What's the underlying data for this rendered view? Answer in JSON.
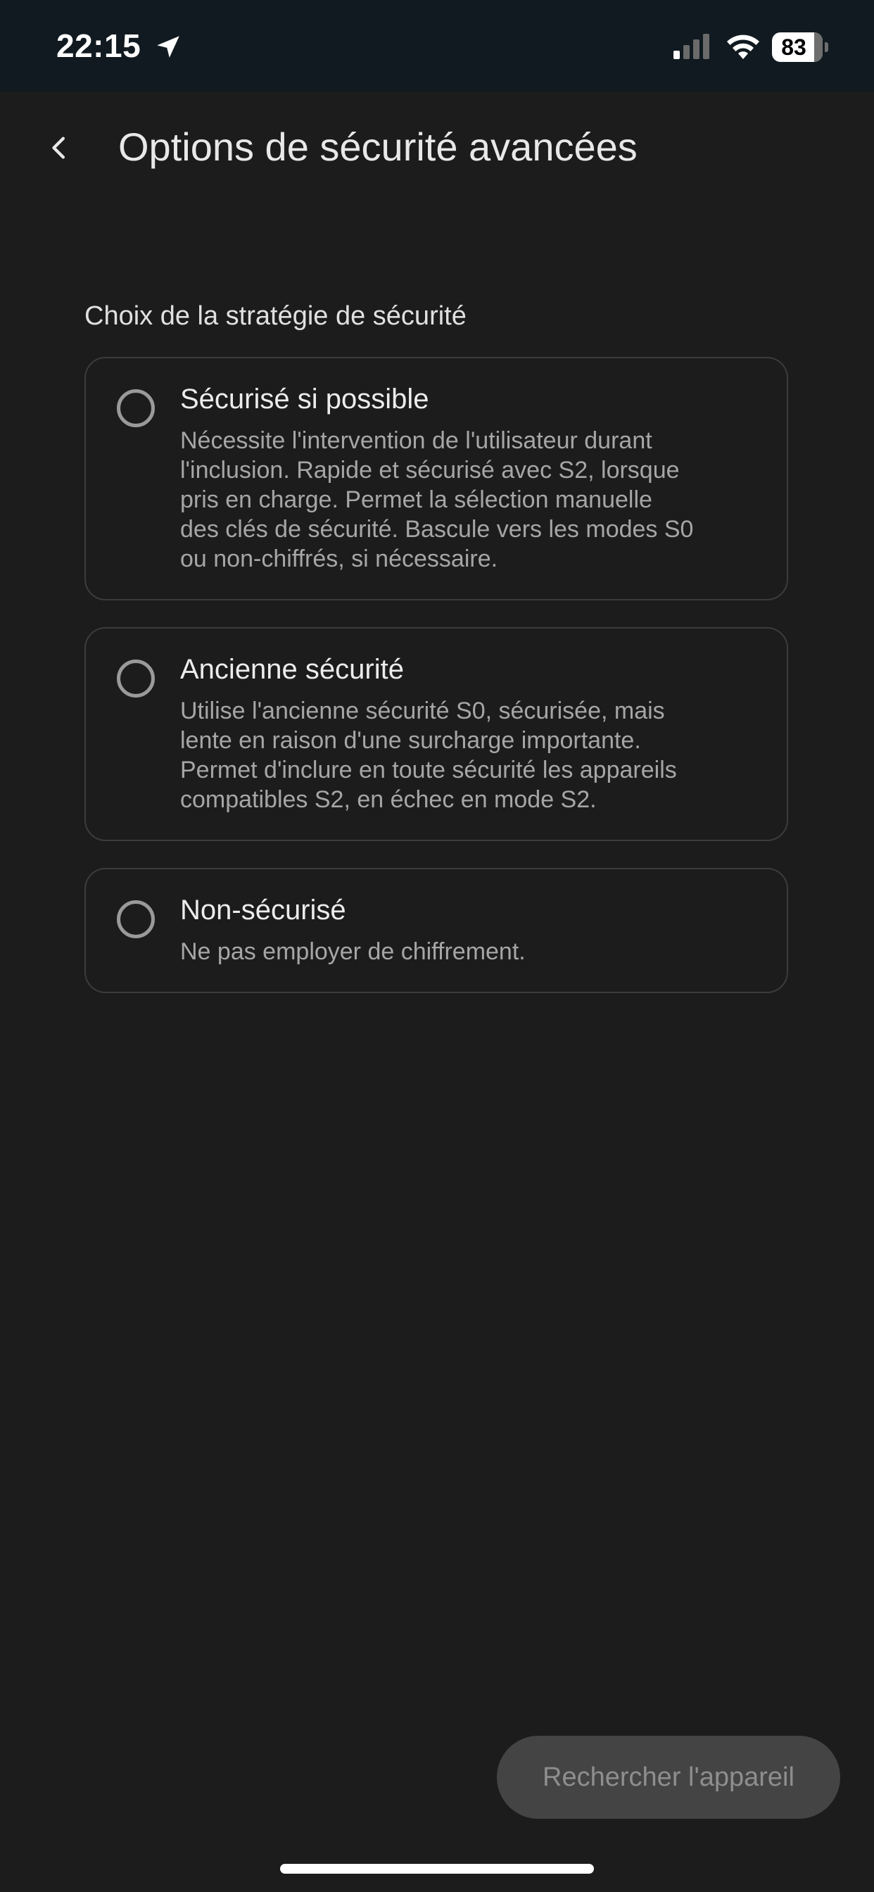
{
  "status_bar": {
    "time": "22:15",
    "battery_level": "83",
    "icons": [
      "location-arrow-icon",
      "cellular-signal-icon",
      "wifi-icon",
      "battery-icon"
    ]
  },
  "header": {
    "back_icon": "chevron-left-icon",
    "title": "Options de sécurité avancées"
  },
  "section": {
    "label": "Choix de la stratégie de sécurité"
  },
  "options": [
    {
      "title": "Sécurisé si possible",
      "description_lines": [
        "Nécessite l'intervention de l'utilisateur durant",
        "l'inclusion. Rapide et sécurisé avec S2, lorsque",
        "pris en charge. Permet la sélection manuelle",
        "des clés de sécurité. Bascule vers les modes S0",
        "ou non-chiffrés, si nécessaire."
      ],
      "selected": false
    },
    {
      "title": "Ancienne sécurité",
      "description_lines": [
        "Utilise l'ancienne sécurité S0, sécurisée, mais",
        "lente en raison d'une surcharge importante.",
        "Permet d'inclure en toute sécurité les appareils",
        "compatibles S2, en échec en mode S2."
      ],
      "selected": false
    },
    {
      "title": "Non-sécurisé",
      "description_lines": [
        "Ne pas employer de chiffrement."
      ],
      "selected": false
    }
  ],
  "actions": {
    "search_label": "Rechercher l'appareil"
  },
  "colors": {
    "background": "#1c1c1c",
    "status_bar": "#101a20",
    "card_border": "#3c3c3c",
    "button_disabled": "#444444"
  }
}
